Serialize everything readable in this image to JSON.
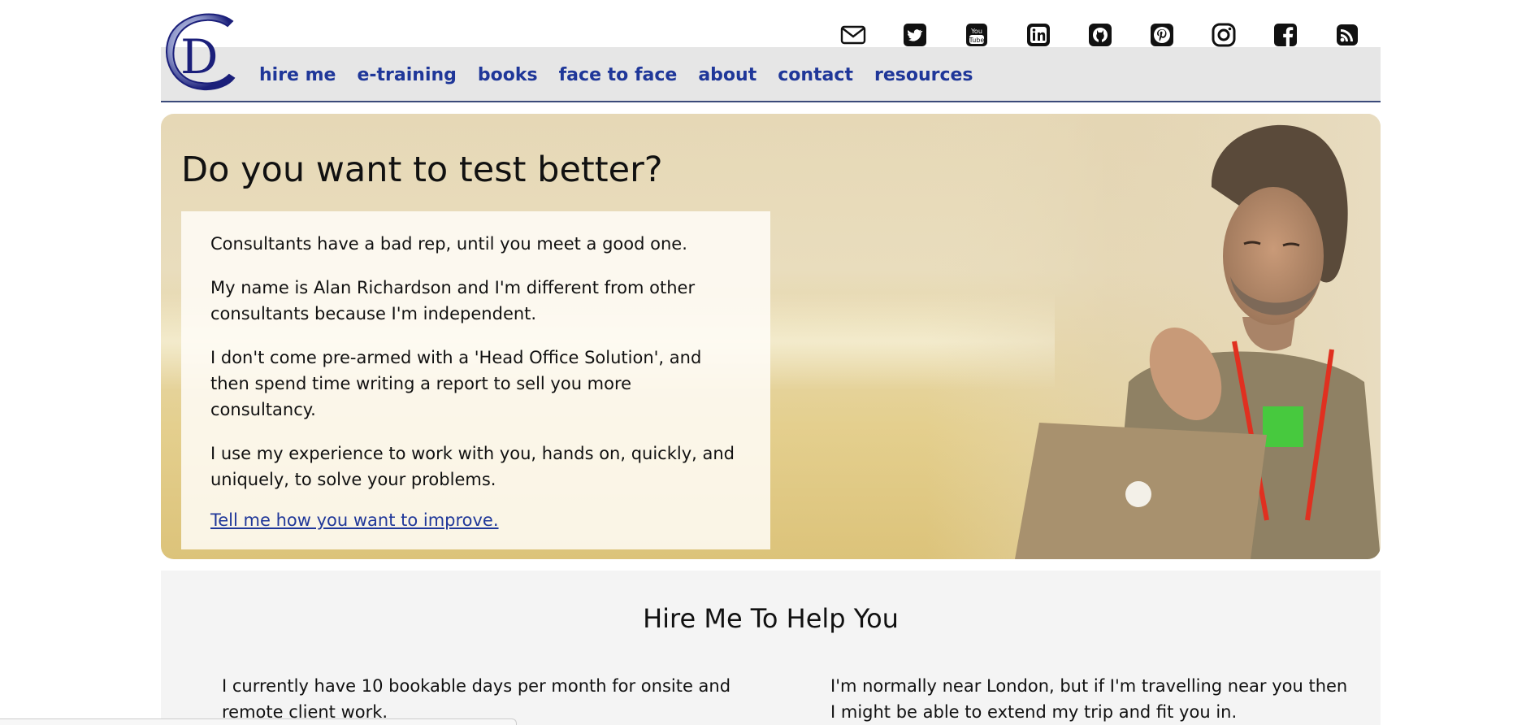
{
  "header": {
    "logo_alt": "CD logo",
    "nav": [
      "hire me",
      "e-training",
      "books",
      "face to face",
      "about",
      "contact",
      "resources"
    ],
    "social_icons": [
      "email-icon",
      "twitter-icon",
      "youtube-icon",
      "linkedin-icon",
      "github-icon",
      "pinterest-icon",
      "instagram-icon",
      "facebook-icon",
      "rss-icon"
    ],
    "colors": {
      "nav_text": "#1f3799",
      "nav_bg": "#e6e6e6",
      "logo_blue": "#1b1f7a"
    }
  },
  "hero": {
    "title": "Do you want to test better?",
    "paragraphs": [
      "Consultants have a bad rep, until you meet a good one.",
      "My name is Alan Richardson and I'm different from other consultants because I'm independent.",
      "I don't come pre-armed with a 'Head Office Solution', and then spend time writing a report to sell you more consultancy.",
      "I use my experience to work with you, hands on, quickly, and uniquely, to solve your problems."
    ],
    "cta_link": "Tell me how you want to improve."
  },
  "hire": {
    "title": "Hire Me To Help You",
    "col1": "I currently have 10 bookable days per month for onsite and remote client work.",
    "col2": "I'm normally near London, but if I'm travelling near you then I might be able to extend my trip and fit you in."
  }
}
